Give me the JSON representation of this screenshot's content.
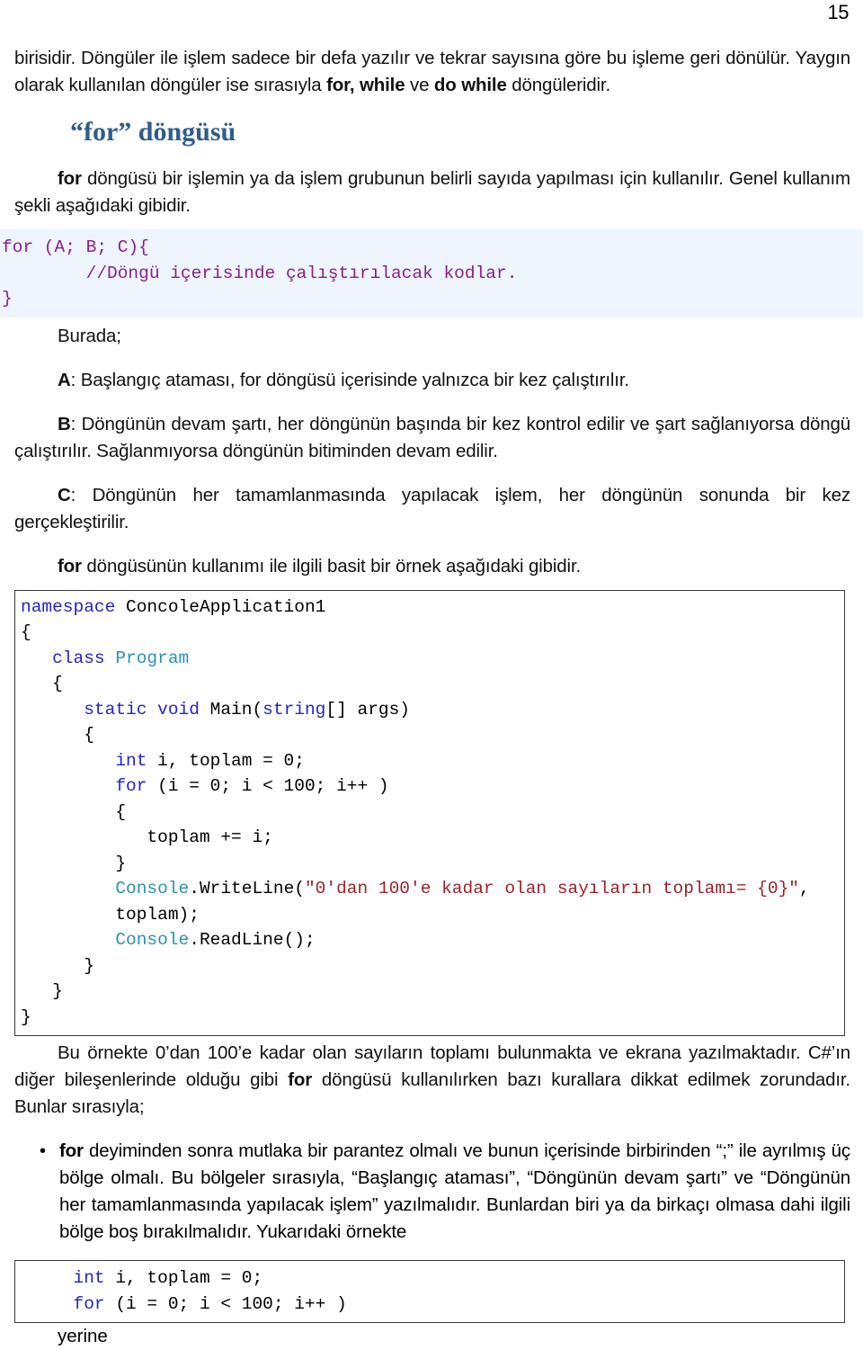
{
  "page": {
    "number": "15"
  },
  "intro": {
    "text_before_for": "birisidir. Döngüler ile işlem sadece bir defa yazılır ve tekrar sayısına göre bu işleme geri dönülür. Yaygın olarak kullanılan döngüler ise sırasıyla ",
    "bold_for_while": "for, while",
    "text_between": " ve ",
    "bold_do_while": "do while",
    "text_after": " döngüleridir."
  },
  "heading": {
    "title": "“for” döngüsü"
  },
  "definition": {
    "bold_for": "for",
    "rest": " döngüsü bir işlemin ya da işlem grubunun belirli sayıda yapılması için kullanılır. Genel kullanım şekli aşağıdaki gibidir."
  },
  "syntax_code": {
    "line1_kw": "for",
    "line1_rest": " (A; B; C){",
    "line2_comment": "        //Döngü içerisinde çalıştırılacak kodlar.",
    "line3": "}"
  },
  "burada": {
    "label": "Burada;"
  },
  "items": {
    "a": {
      "letter": "A",
      "text": ": Başlangıç ataması, for döngüsü içerisinde yalnızca bir kez çalıştırılır."
    },
    "b": {
      "letter": "B",
      "text": ": Döngünün devam şartı, her döngünün başında bir kez kontrol edilir ve şart sağlanıyorsa döngü çalıştırılır. Sağlanmıyorsa döngünün bitiminden devam edilir."
    },
    "c": {
      "letter": "C",
      "text": ": Döngünün her tamamlanmasında yapılacak işlem, her döngünün sonunda bir kez gerçekleştirilir."
    }
  },
  "example_intro": {
    "bold_for": "for",
    "rest": " döngüsünün kullanımı ile ilgili basit bir örnek aşağıdaki gibidir."
  },
  "example_code": {
    "l01_kw": "namespace",
    "l01_rest": " ConcoleApplication1",
    "l02": "{",
    "l03_indent": "   ",
    "l03_kw": "class",
    "l03_type": " Program",
    "l04": "   {",
    "l05_indent": "      ",
    "l05_kw1": "static",
    "l05_kw2": " void",
    "l05_mid": " Main(",
    "l05_kw3": "string",
    "l05_rest": "[] args)",
    "l06": "      {",
    "l07_indent": "         ",
    "l07_kw": "int",
    "l07_rest": " i, toplam = 0;",
    "l08_indent": "         ",
    "l08_kw": "for",
    "l08_rest": " (i = 0; i < 100; i++ )",
    "l09": "         {",
    "l10": "            toplam += i;",
    "l11": "         }",
    "l12_indent": "         ",
    "l12_type": "Console",
    "l12_mid": ".WriteLine(",
    "l12_str": "\"0'dan 100'e kadar olan sayıların toplamı= {0}\"",
    "l12_end": ",",
    "l13": "         toplam);",
    "l14_indent": "         ",
    "l14_type": "Console",
    "l14_rest": ".ReadLine();",
    "l15": "      }",
    "l16": "   }",
    "l17": "}"
  },
  "summary": {
    "part1": "Bu örnekte 0’dan 100’e kadar olan sayıların toplamı bulunmakta ve ekrana yazılmaktadır. C#’ın diğer bileşenlerinde olduğu gibi ",
    "bold_for": "for",
    "part2": " döngüsü kullanılırken bazı kurallara dikkat edilmek zorundadır. Bunlar sırasıyla;"
  },
  "bullet": {
    "marker": "•",
    "bold_for": "for",
    "text": " deyiminden sonra mutlaka bir parantez olmalı ve bunun içerisinde birbirinden “;” ile ayrılmış üç bölge olmalı. Bu bölgeler sırasıyla, “Başlangıç ataması”, “Döngünün devam şartı” ve “Döngünün her tamamlanmasında yapılacak işlem” yazılmalıdır. Bunlardan biri ya da birkaçı olmasa dahi ilgili bölge boş bırakılmalıdır. Yukarıdaki örnekte"
  },
  "final_code": {
    "l1_indent": "     ",
    "l1_kw": "int",
    "l1_rest": " i, toplam = 0;",
    "l2_indent": "     ",
    "l2_kw": "for",
    "l2_rest": " (i = 0; i < 100; i++ )"
  },
  "footer": {
    "yerine": "yerine"
  },
  "colors": {
    "heading_blue": "#2E5C8C",
    "code_keyword_purple": "#8B1E8B",
    "code_keyword_blue": "#2424C8",
    "code_type_teal": "#2B91AF",
    "code_string_red": "#9B2226",
    "code_tint_bg": "#EEF5FD",
    "code_box_border": "#3B3B3B"
  }
}
